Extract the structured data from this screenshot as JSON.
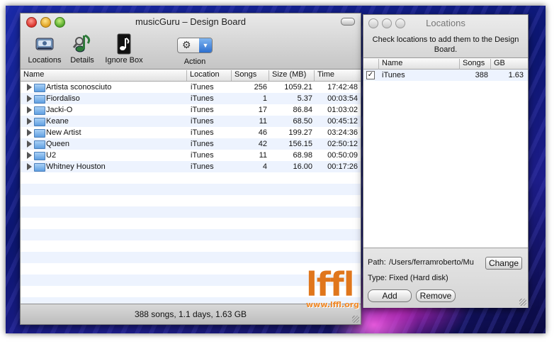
{
  "main_window": {
    "title": "musicGuru – Design Board",
    "toolbar": [
      {
        "label": "Locations",
        "icon": "locations-icon"
      },
      {
        "label": "Details",
        "icon": "details-icon"
      },
      {
        "label": "Ignore Box",
        "icon": "ignore-box-icon"
      }
    ],
    "action_label": "Action",
    "columns": [
      "Name",
      "Location",
      "Songs",
      "Size (MB)",
      "Time"
    ],
    "rows": [
      {
        "name": "Artista sconosciuto",
        "location": "iTunes",
        "songs": "256",
        "size": "1059.21",
        "time": "17:42:48"
      },
      {
        "name": "Fiordaliso",
        "location": "iTunes",
        "songs": "1",
        "size": "5.37",
        "time": "00:03:54"
      },
      {
        "name": "Jacki-O",
        "location": "iTunes",
        "songs": "17",
        "size": "86.84",
        "time": "01:03:02"
      },
      {
        "name": "Keane",
        "location": "iTunes",
        "songs": "11",
        "size": "68.50",
        "time": "00:45:12"
      },
      {
        "name": "New Artist",
        "location": "iTunes",
        "songs": "46",
        "size": "199.27",
        "time": "03:24:36"
      },
      {
        "name": "Queen",
        "location": "iTunes",
        "songs": "42",
        "size": "156.15",
        "time": "02:50:12"
      },
      {
        "name": "U2",
        "location": "iTunes",
        "songs": "11",
        "size": "68.98",
        "time": "00:50:09"
      },
      {
        "name": "Whitney Houston",
        "location": "iTunes",
        "songs": "4",
        "size": "16.00",
        "time": "00:17:26"
      }
    ],
    "status": "388 songs, 1.1 days, 1.63 GB"
  },
  "locations_window": {
    "title": "Locations",
    "instructions": "Check locations to add them to the Design Board.",
    "columns": [
      "Name",
      "Songs",
      "GB"
    ],
    "rows": [
      {
        "checked": "✓",
        "name": "iTunes",
        "songs": "388",
        "gb": "1.63"
      }
    ],
    "path_label": "Path:",
    "path_value": "/Users/ferramroberto/Mu",
    "change_label": "Change",
    "type_text": "Type: Fixed (Hard disk)",
    "add_label": "Add",
    "remove_label": "Remove"
  },
  "watermark": {
    "logo": "lffl",
    "url": "www.lffl.org"
  }
}
